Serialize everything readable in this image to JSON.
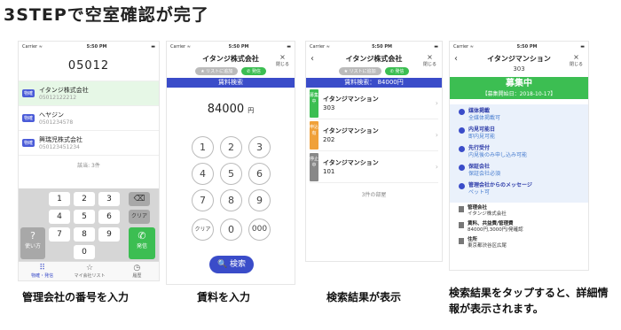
{
  "headline": "3STEPで空室確認が完了",
  "status": {
    "carrier": "Carrier ≈",
    "time": "5:50 PM",
    "battery": "▬"
  },
  "step1": {
    "number": "05012",
    "rows": [
      {
        "badge": "物確",
        "name": "イタンジ株式会社",
        "tel": "05012122212"
      },
      {
        "badge": "物確",
        "name": "ヘヤジン",
        "tel": "0501234578"
      },
      {
        "badge": "物確",
        "name": "興瑞児株式会社",
        "tel": "050123451234"
      }
    ],
    "count": "該当: 3件",
    "keys": {
      "k1": "1",
      "k2": "2",
      "k3": "3",
      "k4": "4",
      "k5": "5",
      "k6": "6",
      "k7": "7",
      "k8": "8",
      "k9": "9",
      "k0": "0",
      "clear": "クリア",
      "help": "使い方",
      "help_icon": "?",
      "call": "発信",
      "call_icon": "✆",
      "del": "⌫"
    },
    "tabs": [
      {
        "icon": "⠿",
        "label": "物確・発信"
      },
      {
        "icon": "☆",
        "label": "マイ会社リスト"
      },
      {
        "icon": "◷",
        "label": "履歴"
      }
    ],
    "caption": "管理会社の番号を入力"
  },
  "step2": {
    "title": "イタンジ株式会社",
    "close_icon": "×",
    "close_label": "閉じる",
    "pill1": "★ リストに追加",
    "pill2": "✆ 発信",
    "bar": "賃料検索",
    "amount": "84000",
    "unit": "円",
    "keys": {
      "k1": "1",
      "k2": "2",
      "k3": "3",
      "k4": "4",
      "k5": "5",
      "k6": "6",
      "k7": "7",
      "k8": "8",
      "k9": "9",
      "k0": "0",
      "clear": "クリア",
      "k000": "000"
    },
    "search": "🔍 検索",
    "caption": "賃料を入力"
  },
  "step3": {
    "back_icon": "‹",
    "title": "イタンジ株式会社",
    "close_icon": "×",
    "close_label": "閉じる",
    "pill1": "★ リストに追加",
    "pill2": "✆ 発信",
    "bar": "賃料検索： 84000円",
    "results": [
      {
        "status": "募集中",
        "color": "#3cbe52",
        "name": "イタンジマンション",
        "room": "303"
      },
      {
        "status": "申込有",
        "color": "#f0a13a",
        "name": "イタンジマンション",
        "room": "202"
      },
      {
        "status": "停止中",
        "color": "#888888",
        "name": "イタンジマンション",
        "room": "101"
      }
    ],
    "chevron": "›",
    "count": "3件の部屋",
    "caption": "検索結果が表示"
  },
  "step4": {
    "back_icon": "‹",
    "title": "イタンジマンション",
    "num": "303",
    "close_icon": "×",
    "close_label": "閉じる",
    "status": "募集中",
    "start": "【募集開始日：2018-10-17】",
    "items": [
      {
        "t": "媒体掲載",
        "v": "全媒体掲載可"
      },
      {
        "t": "内見可能日",
        "v": "即内見可能"
      },
      {
        "t": "先行受付",
        "v": "内見後のみ申し込み可能"
      },
      {
        "t": "保証会社",
        "v": "保証会社必須"
      },
      {
        "t": "管理会社からのメッセージ",
        "v": "ペット可"
      }
    ],
    "info": [
      {
        "t": "管理会社",
        "v": "イタンジ株式会社"
      },
      {
        "t": "賃料、共益費/管理費",
        "v": "84000円,3000円/発確認"
      },
      {
        "t": "住所",
        "v": "東京都渋谷区広尾"
      }
    ],
    "caption": "検索結果をタップすると、詳細情報が表示されます。"
  }
}
